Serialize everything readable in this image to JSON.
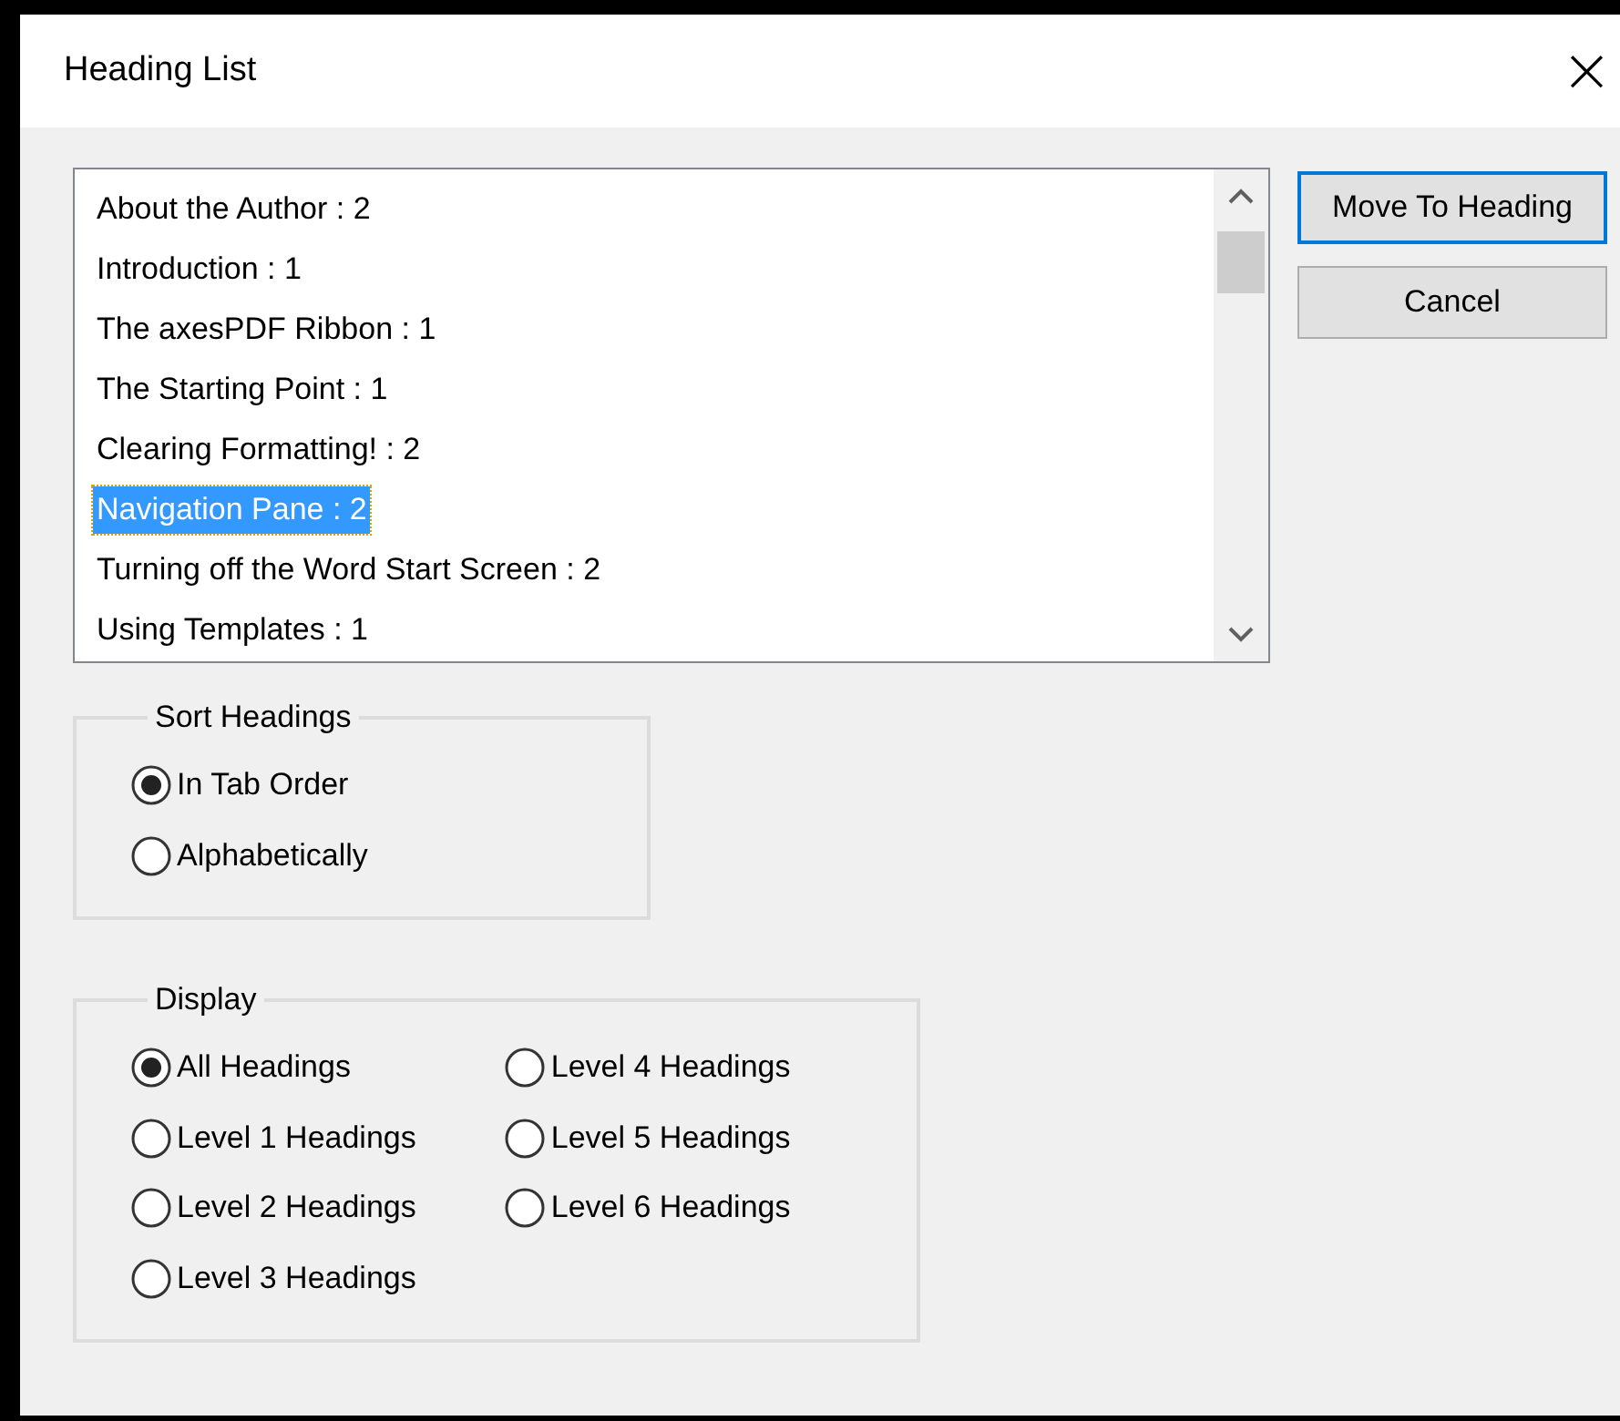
{
  "window": {
    "title": "Heading List",
    "close": "×"
  },
  "headings": [
    {
      "label": "About the Author : 2",
      "selected": false
    },
    {
      "label": "Introduction : 1",
      "selected": false
    },
    {
      "label": "The axesPDF Ribbon : 1",
      "selected": false
    },
    {
      "label": "The Starting Point : 1",
      "selected": false
    },
    {
      "label": "Clearing Formatting! : 2",
      "selected": false
    },
    {
      "label": "Navigation Pane : 2",
      "selected": true
    },
    {
      "label": "Turning off the Word Start Screen : 2",
      "selected": false
    },
    {
      "label": "Using Templates : 1",
      "selected": false
    }
  ],
  "buttons": [
    {
      "label": "Move To Heading",
      "default": true
    },
    {
      "label": "Cancel",
      "default": false
    }
  ],
  "sort_headings": {
    "title": "Sort Headings",
    "options": [
      {
        "label": "In Tab Order",
        "selected": true
      },
      {
        "label": "Alphabetically",
        "selected": false
      }
    ]
  },
  "display": {
    "title": "Display",
    "options": [
      {
        "label": "All Headings",
        "selected": true
      },
      {
        "label": "Level 1 Headings",
        "selected": false
      },
      {
        "label": "Level 2 Headings",
        "selected": false
      },
      {
        "label": "Level 3 Headings",
        "selected": false
      },
      {
        "label": "Level 4 Headings",
        "selected": false
      },
      {
        "label": "Level 5 Headings",
        "selected": false
      },
      {
        "label": "Level 6 Headings",
        "selected": false
      }
    ]
  }
}
